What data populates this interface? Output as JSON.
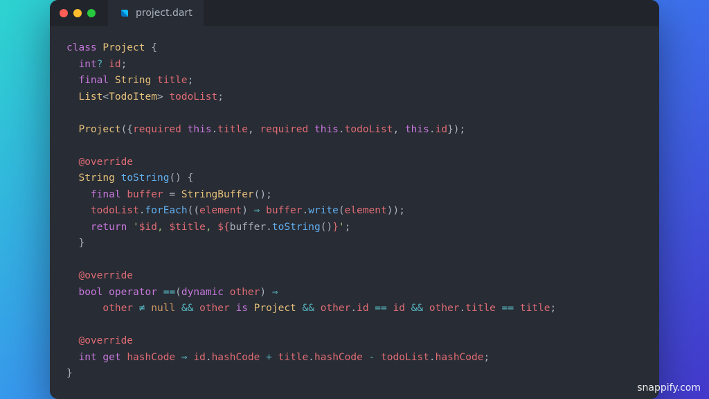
{
  "tab": {
    "filename": "project.dart"
  },
  "watermark": "snappify.com",
  "code": {
    "l1": {
      "kw": "class",
      "type": "Project",
      "brace": " {"
    },
    "l2": {
      "indent": "  ",
      "type": "int",
      "q": "?",
      "ident": " id",
      "end": ";"
    },
    "l3": {
      "indent": "  ",
      "kw": "final ",
      "type": "String",
      "ident": " title",
      "end": ";"
    },
    "l4": {
      "indent": "  ",
      "type": "List",
      "lt": "<",
      "type2": "TodoItem",
      "gt": ">",
      "ident": " todoList",
      "end": ";"
    },
    "l6a": {
      "indent": "  ",
      "type": "Project",
      "paren": "({"
    },
    "l6b": {
      "kw": "required ",
      "this": "this",
      "dot": ".",
      "ident": "title"
    },
    "l6c": {
      "sep": ", ",
      "kw": "required ",
      "this": "this",
      "dot": ".",
      "ident": "todoList"
    },
    "l6d": {
      "sep": ", ",
      "this": "this",
      "dot": ".",
      "ident": "id",
      "end": "});"
    },
    "l8": {
      "indent": "  ",
      "ann": "@override"
    },
    "l9": {
      "indent": "  ",
      "type": "String",
      "fn": " toString",
      "paren": "() {"
    },
    "l10": {
      "indent": "    ",
      "kw": "final ",
      "ident": "buffer",
      "eq": " = ",
      "type": "StringBuffer",
      "call": "();"
    },
    "l11": {
      "indent": "    ",
      "ident": "todoList",
      "dot": ".",
      "fn": "forEach",
      "open": "((",
      "param": "element",
      "close": ") ",
      "arrow": "⇒",
      "body": " buffer",
      "dot2": ".",
      "fn2": "write",
      "open2": "(",
      "arg": "element",
      "close2": "));"
    },
    "l12": {
      "indent": "    ",
      "kw": "return ",
      "q1": "'",
      "s1": "$id",
      "s2": ", ",
      "s3": "$title",
      "s4": ", ",
      "s5": "${",
      "ident": "buffer",
      "dot": ".",
      "fn": "toString",
      "call": "()",
      "s6": "}",
      "q2": "'",
      "end": ";"
    },
    "l13": {
      "indent": "  ",
      "brace": "}"
    },
    "l15": {
      "indent": "  ",
      "ann": "@override"
    },
    "l16": {
      "indent": "  ",
      "type": "bool",
      "kw": " operator ",
      "op": "==",
      "open": "(",
      "dyn": "dynamic",
      "ident": " other",
      "close": ") ",
      "arrow": "⇒"
    },
    "l17": {
      "indent": "      ",
      "ident": "other",
      "ne": " ≠ ",
      "null": "null",
      "and1": " && ",
      "ident2": "other",
      "is": " is ",
      "type": "Project",
      "and2": " && ",
      "ident3": "other",
      "dot": ".",
      "field": "id",
      "eq": " == ",
      "field2": "id",
      "and3": " && ",
      "ident4": "other",
      "dot2": ".",
      "field3": "title",
      "eq2": " == ",
      "field4": "title",
      "end": ";"
    },
    "l19": {
      "indent": "  ",
      "ann": "@override"
    },
    "l20": {
      "indent": "  ",
      "type": "int",
      "kw": " get ",
      "ident": "hashCode",
      "arrow": " ⇒ ",
      "e1": "id",
      "dot1": ".",
      "p1": "hashCode",
      "plus": " + ",
      "e2": "title",
      "dot2": ".",
      "p2": "hashCode",
      "minus": " - ",
      "e3": "todoList",
      "dot3": ".",
      "p3": "hashCode",
      "end": ";"
    },
    "l21": {
      "brace": "}"
    }
  }
}
